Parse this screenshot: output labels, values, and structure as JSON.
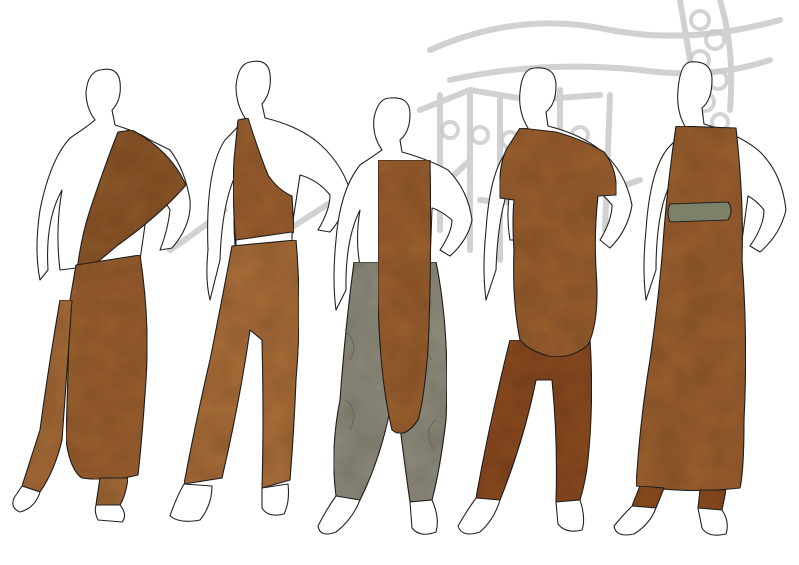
{
  "scene": {
    "description_free": true,
    "colors": {
      "background": "#ffffff",
      "backdrop_sketch": "#c9c9c9",
      "leather": "#9a5f2e",
      "leather_dark": "#6e3e1a",
      "leather_light": "#b7763d",
      "grey_fabric": "#8f8c7c",
      "grey_fabric_dark": "#6d6a5c",
      "belt": "#7e8069",
      "outline": "#222222",
      "skin": "#ffffff"
    },
    "figures": [
      {
        "name": "figure-1",
        "outfit": "one-shoulder-drape-with-long-panel"
      },
      {
        "name": "figure-2",
        "outfit": "one-shoulder-vest-and-trousers"
      },
      {
        "name": "figure-3",
        "outfit": "long-front-panel-over-grey-harem-pants"
      },
      {
        "name": "figure-4",
        "outfit": "short-sleeve-tunic-with-rounded-hem-and-leggings"
      },
      {
        "name": "figure-5",
        "outfit": "sleeveless-long-dress-with-grey-belt"
      }
    ]
  }
}
